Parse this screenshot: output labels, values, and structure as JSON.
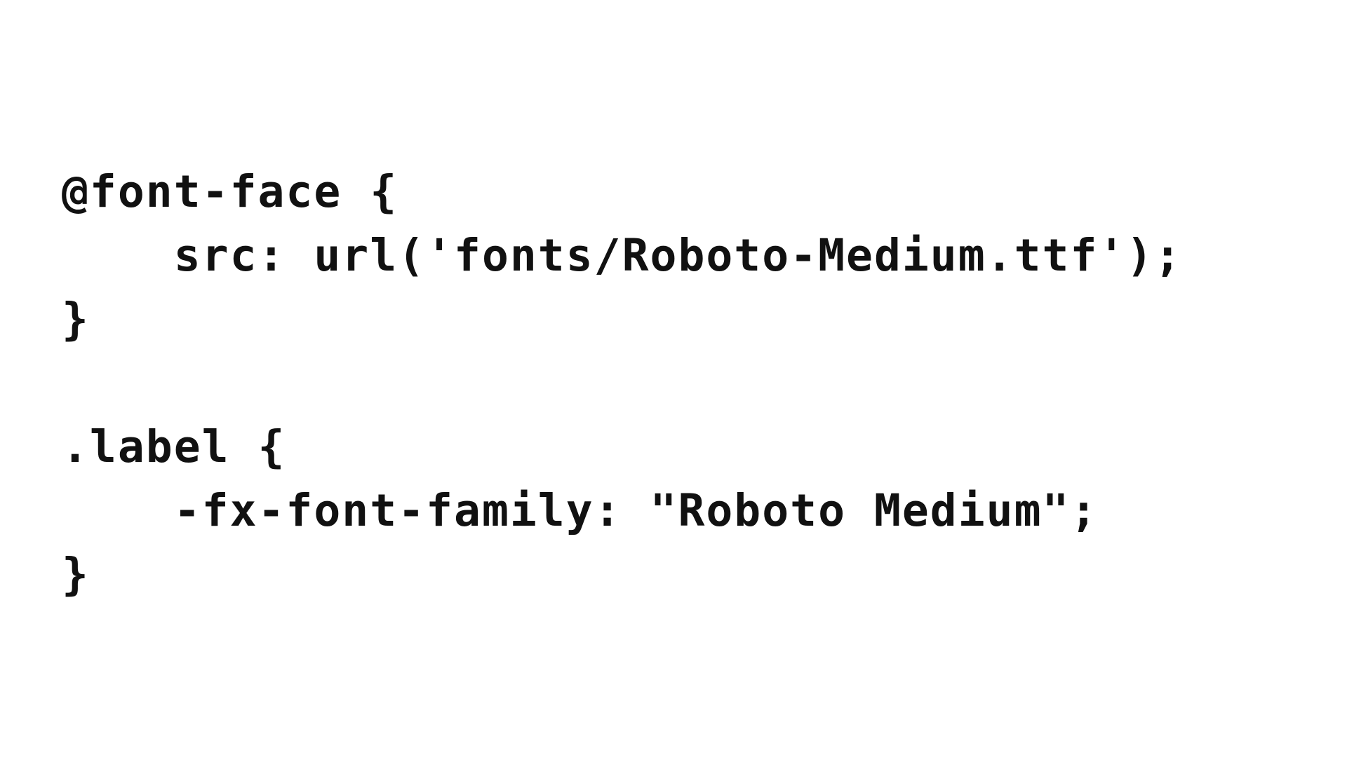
{
  "code": {
    "lines": [
      "@font-face {",
      "    src: url('fonts/Roboto-Medium.ttf');",
      "}",
      "",
      ".label {",
      "    -fx-font-family: \"Roboto Medium\";",
      "}"
    ]
  },
  "colors": {
    "background": "#ffffff",
    "text": "#111111"
  }
}
